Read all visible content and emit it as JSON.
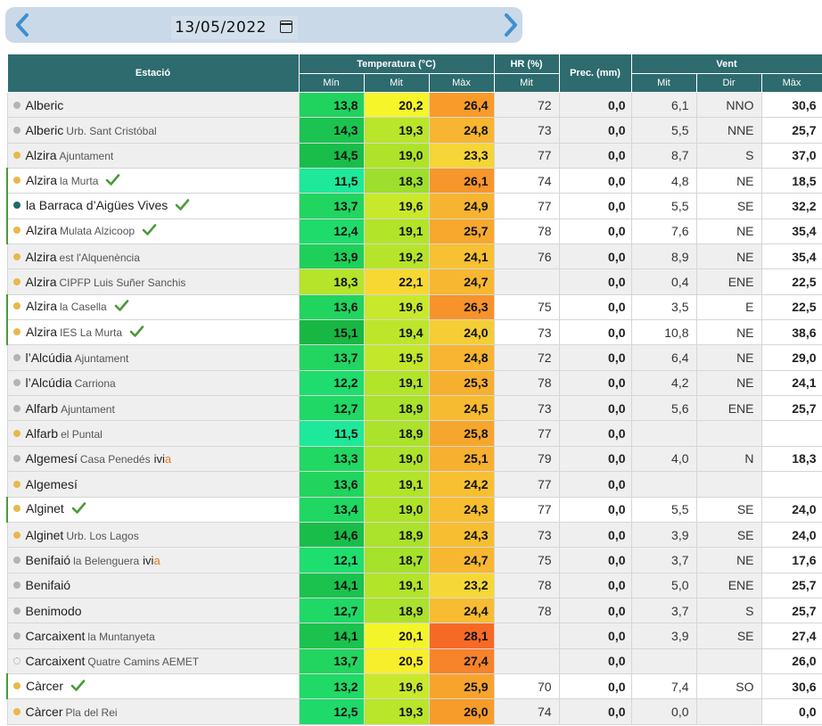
{
  "date": "13/05/2022",
  "nav": {
    "prev_icon": "chevron-left-icon",
    "next_icon": "chevron-right-icon",
    "calendar_icon": "calendar-icon"
  },
  "header": {
    "station": "Estació",
    "temperature": "Temperatura (°C)",
    "hr": "HR (%)",
    "prec": "Prec. (mm)",
    "wind": "Vent",
    "t_min": "Mín",
    "t_avg": "Mit",
    "t_max": "Màx",
    "hr_avg": "Mit",
    "w_avg": "Mit",
    "w_dir": "Dir",
    "w_max": "Màx"
  },
  "colors": {
    "dot_grey": "#b3b3b3",
    "dot_yellow": "#e9b84a",
    "dot_teal": "#1e6b6a",
    "tick_green": "#4b9a3a",
    "header_bg": "#2d6b6f"
  },
  "rows": [
    {
      "name": "Alberic",
      "sub": "",
      "dot": "grey",
      "tick": false,
      "ivi": false,
      "hl": false,
      "min": "13,8",
      "avg": "20,2",
      "max": "26,4",
      "hr": "72",
      "prec": "0,0",
      "wavg": "6,1",
      "wdir": "NNO",
      "wmax": "30,6",
      "cmin": "#1fd35e",
      "cavg": "#f5f52a",
      "cmax": "#f99b2a"
    },
    {
      "name": "Alberic",
      "sub": "Urb. Sant Cristóbal",
      "dot": "grey",
      "tick": false,
      "ivi": false,
      "hl": false,
      "min": "14,3",
      "avg": "19,3",
      "max": "24,8",
      "hr": "73",
      "prec": "0,0",
      "wavg": "5,5",
      "wdir": "NNE",
      "wmax": "25,7",
      "cmin": "#1bc450",
      "cavg": "#b9e52a",
      "cmax": "#f7b531"
    },
    {
      "name": "Alzira",
      "sub": "Ajuntament",
      "dot": "yellow",
      "tick": false,
      "ivi": false,
      "hl": false,
      "min": "14,5",
      "avg": "19,0",
      "max": "23,3",
      "hr": "77",
      "prec": "0,0",
      "wavg": "8,7",
      "wdir": "S",
      "wmax": "37,0",
      "cmin": "#19bd4a",
      "cavg": "#aee32a",
      "cmax": "#f5d537"
    },
    {
      "name": "Alzira",
      "sub": "la Murta",
      "dot": "yellow",
      "tick": true,
      "ivi": false,
      "hl": true,
      "min": "11,5",
      "avg": "18,3",
      "max": "26,1",
      "hr": "74",
      "prec": "0,0",
      "wavg": "4,8",
      "wdir": "NE",
      "wmax": "18,5",
      "cmin": "#1ee899",
      "cavg": "#9ddf2c",
      "cmax": "#f7962a"
    },
    {
      "name": "la Barraca d’Aigües Vives",
      "sub": "",
      "dot": "teal",
      "tick": true,
      "ivi": false,
      "hl": true,
      "min": "13,7",
      "avg": "19,6",
      "max": "24,9",
      "hr": "77",
      "prec": "0,0",
      "wavg": "5,5",
      "wdir": "SE",
      "wmax": "32,2",
      "cmin": "#22d560",
      "cavg": "#c8e92b",
      "cmax": "#f7b431"
    },
    {
      "name": "Alzira",
      "sub": "Mulata Alzicoop",
      "dot": "yellow",
      "tick": true,
      "ivi": false,
      "hl": true,
      "min": "12,4",
      "avg": "19,1",
      "max": "25,7",
      "hr": "78",
      "prec": "0,0",
      "wavg": "7,6",
      "wdir": "NE",
      "wmax": "35,4",
      "cmin": "#1fdb6b",
      "cavg": "#b2e42a",
      "cmax": "#f7a82d"
    },
    {
      "name": "Alzira",
      "sub": "est l'Alquenència",
      "dot": "yellow",
      "tick": false,
      "ivi": false,
      "hl": false,
      "min": "13,9",
      "avg": "19,2",
      "max": "24,1",
      "hr": "76",
      "prec": "0,0",
      "wavg": "8,9",
      "wdir": "NE",
      "wmax": "35,4",
      "cmin": "#1ed05a",
      "cavg": "#b6e42a",
      "cmax": "#f7c133"
    },
    {
      "name": "Alzira",
      "sub": "CIPFP Luis Suñer Sanchis",
      "dot": "yellow",
      "tick": false,
      "ivi": false,
      "hl": false,
      "min": "18,3",
      "avg": "22,1",
      "max": "24,7",
      "hr": "",
      "prec": "0,0",
      "wavg": "0,4",
      "wdir": "ENE",
      "wmax": "22,5",
      "cmin": "#b5e42a",
      "cavg": "#f7d833",
      "cmax": "#f7b731"
    },
    {
      "name": "Alzira",
      "sub": "la Casella",
      "dot": "yellow",
      "tick": true,
      "ivi": false,
      "hl": true,
      "min": "13,6",
      "avg": "19,6",
      "max": "26,3",
      "hr": "75",
      "prec": "0,0",
      "wavg": "3,5",
      "wdir": "E",
      "wmax": "22,5",
      "cmin": "#20d45e",
      "cavg": "#c8e92b",
      "cmax": "#f7932a"
    },
    {
      "name": "Alzira",
      "sub": "IES La Murta",
      "dot": "yellow",
      "tick": true,
      "ivi": false,
      "hl": true,
      "min": "15,1",
      "avg": "19,4",
      "max": "24,0",
      "hr": "73",
      "prec": "0,0",
      "wavg": "10,8",
      "wdir": "NE",
      "wmax": "38,6",
      "cmin": "#18b744",
      "cavg": "#bde62b",
      "cmax": "#f5cd35"
    },
    {
      "name": "l’Alcúdia",
      "sub": "Ajuntament",
      "dot": "grey",
      "tick": false,
      "ivi": false,
      "hl": false,
      "min": "13,7",
      "avg": "19,5",
      "max": "24,8",
      "hr": "72",
      "prec": "0,0",
      "wavg": "6,4",
      "wdir": "NE",
      "wmax": "29,0",
      "cmin": "#22d560",
      "cavg": "#c3e72b",
      "cmax": "#f7b531"
    },
    {
      "name": "l’Alcúdia",
      "sub": "Carriona",
      "dot": "grey",
      "tick": false,
      "ivi": false,
      "hl": false,
      "min": "12,2",
      "avg": "19,1",
      "max": "25,3",
      "hr": "78",
      "prec": "0,0",
      "wavg": "4,2",
      "wdir": "NE",
      "wmax": "24,1",
      "cmin": "#1fdc6e",
      "cavg": "#b2e42a",
      "cmax": "#f7af2f"
    },
    {
      "name": "Alfarb",
      "sub": "Ajuntament",
      "dot": "grey",
      "tick": false,
      "ivi": false,
      "hl": false,
      "min": "12,7",
      "avg": "18,9",
      "max": "24,5",
      "hr": "73",
      "prec": "0,0",
      "wavg": "5,6",
      "wdir": "ENE",
      "wmax": "25,7",
      "cmin": "#1fd866",
      "cavg": "#abe22b",
      "cmax": "#f7bb32"
    },
    {
      "name": "Alfarb",
      "sub": "el Puntal",
      "dot": "yellow",
      "tick": false,
      "ivi": false,
      "hl": false,
      "min": "11,5",
      "avg": "18,9",
      "max": "25,8",
      "hr": "77",
      "prec": "0,0",
      "wavg": "",
      "wdir": "",
      "wmax": "",
      "cmin": "#1ee899",
      "cavg": "#abe22b",
      "cmax": "#f7a62d"
    },
    {
      "name": "Algemesí",
      "sub": "Casa Penedés",
      "dot": "grey",
      "tick": false,
      "ivi": true,
      "hl": false,
      "min": "13,3",
      "avg": "19,0",
      "max": "25,1",
      "hr": "79",
      "prec": "0,0",
      "wavg": "4,0",
      "wdir": "N",
      "wmax": "18,3",
      "cmin": "#20d863",
      "cavg": "#aee32a",
      "cmax": "#f7b02f"
    },
    {
      "name": "Algemesí",
      "sub": "",
      "dot": "yellow",
      "tick": false,
      "ivi": false,
      "hl": false,
      "min": "13,6",
      "avg": "19,1",
      "max": "24,2",
      "hr": "77",
      "prec": "0,0",
      "wavg": "",
      "wdir": "",
      "wmax": "",
      "cmin": "#20d45e",
      "cavg": "#b2e42a",
      "cmax": "#f7c033"
    },
    {
      "name": "Alginet",
      "sub": "",
      "dot": "yellow",
      "tick": true,
      "ivi": false,
      "hl": true,
      "min": "13,4",
      "avg": "19,0",
      "max": "24,3",
      "hr": "77",
      "prec": "0,0",
      "wavg": "5,5",
      "wdir": "SE",
      "wmax": "24,0",
      "cmin": "#20d762",
      "cavg": "#aee32a",
      "cmax": "#f7be32"
    },
    {
      "name": "Alginet",
      "sub": "Urb. Los Lagos",
      "dot": "yellow",
      "tick": false,
      "ivi": false,
      "hl": false,
      "min": "14,6",
      "avg": "18,9",
      "max": "24,3",
      "hr": "73",
      "prec": "0,0",
      "wavg": "3,9",
      "wdir": "SE",
      "wmax": "24,0",
      "cmin": "#19bd4a",
      "cavg": "#abe22b",
      "cmax": "#f7be32"
    },
    {
      "name": "Benifaió",
      "sub": "la Belenguera",
      "dot": "grey",
      "tick": false,
      "ivi": true,
      "hl": false,
      "min": "12,1",
      "avg": "18,7",
      "max": "24,7",
      "hr": "75",
      "prec": "0,0",
      "wavg": "3,7",
      "wdir": "NE",
      "wmax": "17,6",
      "cmin": "#1fde70",
      "cavg": "#a6e12b",
      "cmax": "#f7b731"
    },
    {
      "name": "Benifaió",
      "sub": "",
      "dot": "grey",
      "tick": false,
      "ivi": false,
      "hl": false,
      "min": "14,1",
      "avg": "19,1",
      "max": "23,2",
      "hr": "78",
      "prec": "0,0",
      "wavg": "5,0",
      "wdir": "ENE",
      "wmax": "25,7",
      "cmin": "#1bc24e",
      "cavg": "#b2e42a",
      "cmax": "#f5d837"
    },
    {
      "name": "Benimodo",
      "sub": "",
      "dot": "grey",
      "tick": false,
      "ivi": false,
      "hl": false,
      "min": "12,7",
      "avg": "18,9",
      "max": "24,4",
      "hr": "78",
      "prec": "0,0",
      "wavg": "3,7",
      "wdir": "S",
      "wmax": "25,7",
      "cmin": "#1fd866",
      "cavg": "#abe22b",
      "cmax": "#f7bc32"
    },
    {
      "name": "Carcaixent",
      "sub": "la Muntanyeta",
      "dot": "grey",
      "tick": false,
      "ivi": false,
      "hl": false,
      "min": "14,1",
      "avg": "20,1",
      "max": "28,1",
      "hr": "",
      "prec": "0,0",
      "wavg": "3,9",
      "wdir": "SE",
      "wmax": "27,4",
      "cmin": "#1bc24e",
      "cavg": "#f3f52a",
      "cmax": "#f76a26"
    },
    {
      "name": "Carcaixent",
      "sub": "Quatre Camins AEMET",
      "dot": "none",
      "tick": false,
      "ivi": false,
      "hl": false,
      "min": "13,7",
      "avg": "20,5",
      "max": "27,4",
      "hr": "",
      "prec": "0,0",
      "wavg": "",
      "wdir": "",
      "wmax": "26,0",
      "cmin": "#22d560",
      "cavg": "#f7ef2c",
      "cmax": "#f7832a"
    },
    {
      "name": "Càrcer",
      "sub": "",
      "dot": "yellow",
      "tick": true,
      "ivi": false,
      "hl": true,
      "min": "13,2",
      "avg": "19,6",
      "max": "25,9",
      "hr": "70",
      "prec": "0,0",
      "wavg": "7,4",
      "wdir": "SO",
      "wmax": "30,6",
      "cmin": "#20d966",
      "cavg": "#c8e92b",
      "cmax": "#f7a42d"
    },
    {
      "name": "Càrcer",
      "sub": "Pla del Rei",
      "dot": "yellow",
      "tick": false,
      "ivi": false,
      "hl": false,
      "min": "12,5",
      "avg": "19,3",
      "max": "26,0",
      "hr": "74",
      "prec": "0,0",
      "wavg": "0,0",
      "wdir": "",
      "wmax": "0,0",
      "cmin": "#1fda6a",
      "cavg": "#b9e52a",
      "cmax": "#f79c2b"
    }
  ]
}
